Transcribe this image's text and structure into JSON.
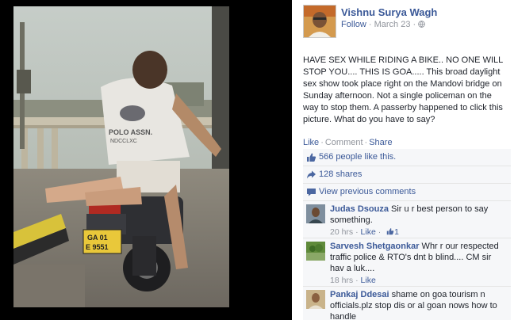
{
  "post": {
    "author": "Vishnu Surya Wagh",
    "follow_label": "Follow",
    "separator": "·",
    "date": "March 23",
    "separator2": "·",
    "text": "HAVE SEX WHILE RIDING A BIKE.. NO ONE WILL STOP YOU.... THIS IS GOA..... This broad daylight sex show took place right on the Mandovi bridge on Sunday afternoon. Not a single policeman on the way to stop them. A passerby happened to click this picture. What do you have to say?"
  },
  "actions": {
    "like": "Like",
    "sep1": "·",
    "comment": "Comment",
    "sep2": "·",
    "share": "Share"
  },
  "stats": {
    "likes": "566 people like this.",
    "shares": "128 shares",
    "view_previous": "View previous comments"
  },
  "photo": {
    "shirt_line1": "POLO ASSN.",
    "shirt_line2": "NDCCLXC",
    "plate_line1": "GA 01",
    "plate_line2": "E 9551"
  },
  "comments": [
    {
      "name": "Judas Dsouza",
      "text": " Sir u r best person to say something.",
      "time": "20 hrs",
      "sep": "·",
      "like": "Like",
      "sep2": "·",
      "like_count": "1"
    },
    {
      "name": "Sarvesh Shetgaonkar",
      "text": " Whr r our respected traffic police & RTO's dnt b blind.... CM sir hav a luk....",
      "time": "18 hrs",
      "sep": "·",
      "like": "Like"
    },
    {
      "name": "Pankaj Ddesai",
      "text": " shame on goa tourism n officials.plz stop dis or al goan nows how to handle"
    }
  ],
  "colors": {
    "link": "#3b5998",
    "muted": "#90949c",
    "panel": "#f6f7f9"
  }
}
